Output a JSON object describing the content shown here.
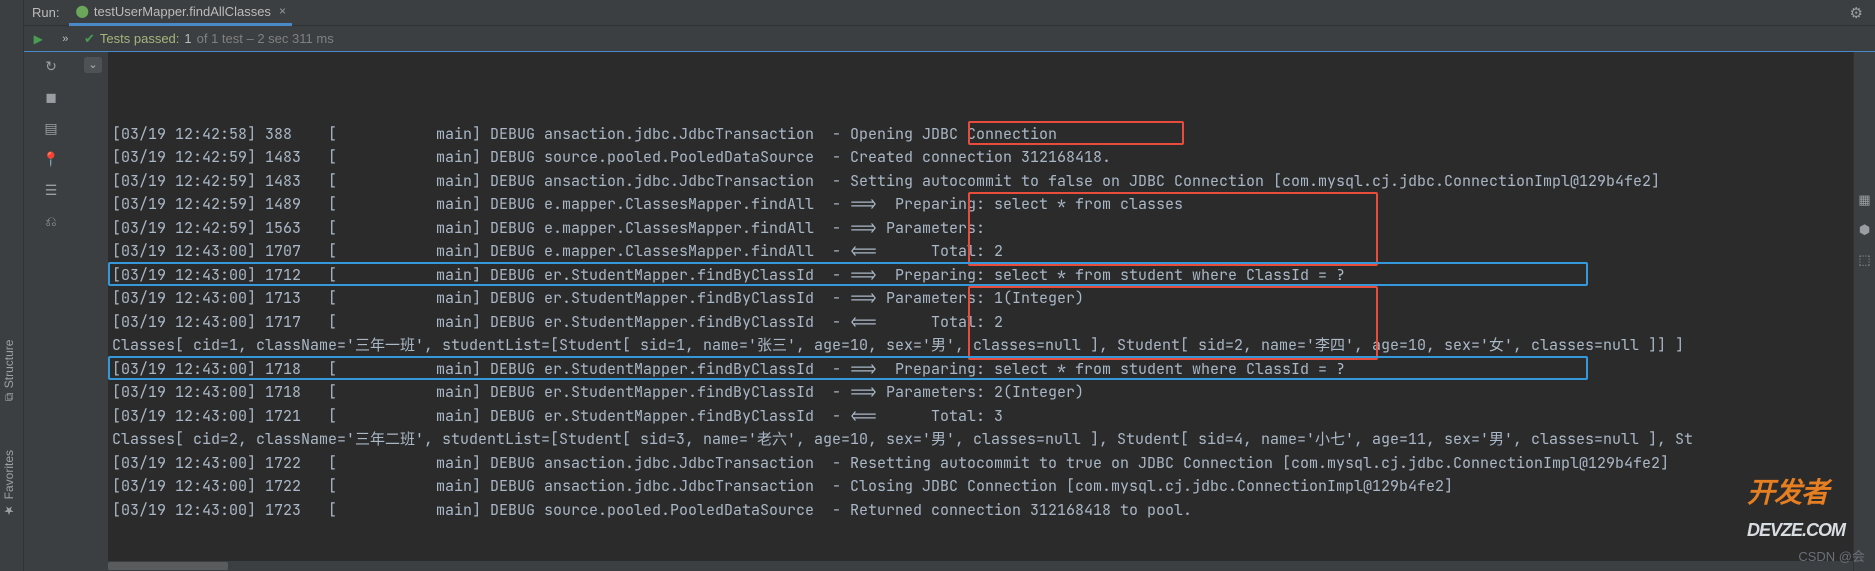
{
  "header": {
    "run_label": "Run:",
    "tab_title": "testUserMapper.findAllClasses",
    "tab_close": "×"
  },
  "test_status": {
    "prefix": "»",
    "passed_label": "Tests passed:",
    "count": "1",
    "total_suffix": "of 1 test – 2 sec 311 ms"
  },
  "side_labels": {
    "structure": "Structure",
    "favorites": "Favorites"
  },
  "console_lines": [
    "[03/19 12:42:58] 388    [           main] DEBUG ansaction.jdbc.JdbcTransaction  - Opening JDBC Connection",
    "[03/19 12:42:59] 1483   [           main] DEBUG source.pooled.PooledDataSource  - Created connection 312168418.",
    "[03/19 12:42:59] 1483   [           main] DEBUG ansaction.jdbc.JdbcTransaction  - Setting autocommit to false on JDBC Connection [com.mysql.cj.jdbc.ConnectionImpl@129b4fe2]",
    "[03/19 12:42:59] 1489   [           main] DEBUG e.mapper.ClassesMapper.findAll  - ==>  Preparing: select * from classes",
    "[03/19 12:42:59] 1563   [           main] DEBUG e.mapper.ClassesMapper.findAll  - ==> Parameters: ",
    "[03/19 12:43:00] 1707   [           main] DEBUG e.mapper.ClassesMapper.findAll  - <==      Total: 2",
    "[03/19 12:43:00] 1712   [           main] DEBUG er.StudentMapper.findByClassId  - ==>  Preparing: select * from student where ClassId = ?",
    "[03/19 12:43:00] 1713   [           main] DEBUG er.StudentMapper.findByClassId  - ==> Parameters: 1(Integer)",
    "[03/19 12:43:00] 1717   [           main] DEBUG er.StudentMapper.findByClassId  - <==      Total: 2",
    "Classes[ cid=1, className='三年一班', studentList=[Student[ sid=1, name='张三', age=10, sex='男', classes=null ], Student[ sid=2, name='李四', age=10, sex='女', classes=null ]] ]",
    "[03/19 12:43:00] 1718   [           main] DEBUG er.StudentMapper.findByClassId  - ==>  Preparing: select * from student where ClassId = ?",
    "[03/19 12:43:00] 1718   [           main] DEBUG er.StudentMapper.findByClassId  - ==> Parameters: 2(Integer)",
    "[03/19 12:43:00] 1721   [           main] DEBUG er.StudentMapper.findByClassId  - <==      Total: 3",
    "Classes[ cid=2, className='三年二班', studentList=[Student[ sid=3, name='老六', age=10, sex='男', classes=null ], Student[ sid=4, name='小七', age=11, sex='男', classes=null ], St",
    "[03/19 12:43:00] 1722   [           main] DEBUG ansaction.jdbc.JdbcTransaction  - Resetting autocommit to true on JDBC Connection [com.mysql.cj.jdbc.ConnectionImpl@129b4fe2]",
    "[03/19 12:43:00] 1722   [           main] DEBUG ansaction.jdbc.JdbcTransaction  - Closing JDBC Connection [com.mysql.cj.jdbc.ConnectionImpl@129b4fe2]",
    "[03/19 12:43:00] 1723   [           main] DEBUG source.pooled.PooledDataSource  - Returned connection 312168418 to pool."
  ],
  "overlays": {
    "watermark": "CSDN @会",
    "logo1": "开发者",
    "logo2": "DEVZE.COM"
  }
}
